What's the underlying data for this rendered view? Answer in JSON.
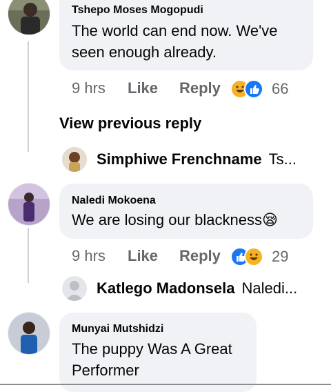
{
  "comments": [
    {
      "author": "Tshepo Moses Mogopudi",
      "text_lines": [
        "The world can end now.  We've",
        "seen enough already."
      ],
      "time": "9 hrs",
      "like": "Like",
      "reply": "Reply",
      "reactions": [
        "haha",
        "like"
      ],
      "reaction_count": "66"
    },
    {
      "author": "Naledi Mokoena",
      "text_lines": [
        "We are losing our blackness😪"
      ],
      "time": "9 hrs",
      "like": "Like",
      "reply": "Reply",
      "reactions": [
        "like",
        "haha"
      ],
      "reaction_count": "29"
    },
    {
      "author": "Munyai Mutshidzi",
      "text_lines": [
        "The puppy Was A Great",
        "Performer"
      ]
    }
  ],
  "view_previous_reply": "View previous reply",
  "replies": [
    {
      "author": "Simphiwe Frenchname",
      "snippet": "Ts..."
    },
    {
      "author": "Katlego Madonsela",
      "snippet": "Naledi..."
    }
  ],
  "colors": {
    "bubble": "#f0f2f5",
    "meta": "#65676b",
    "like_blue": "#1877f2",
    "haha_yellow": "#f7b125"
  }
}
